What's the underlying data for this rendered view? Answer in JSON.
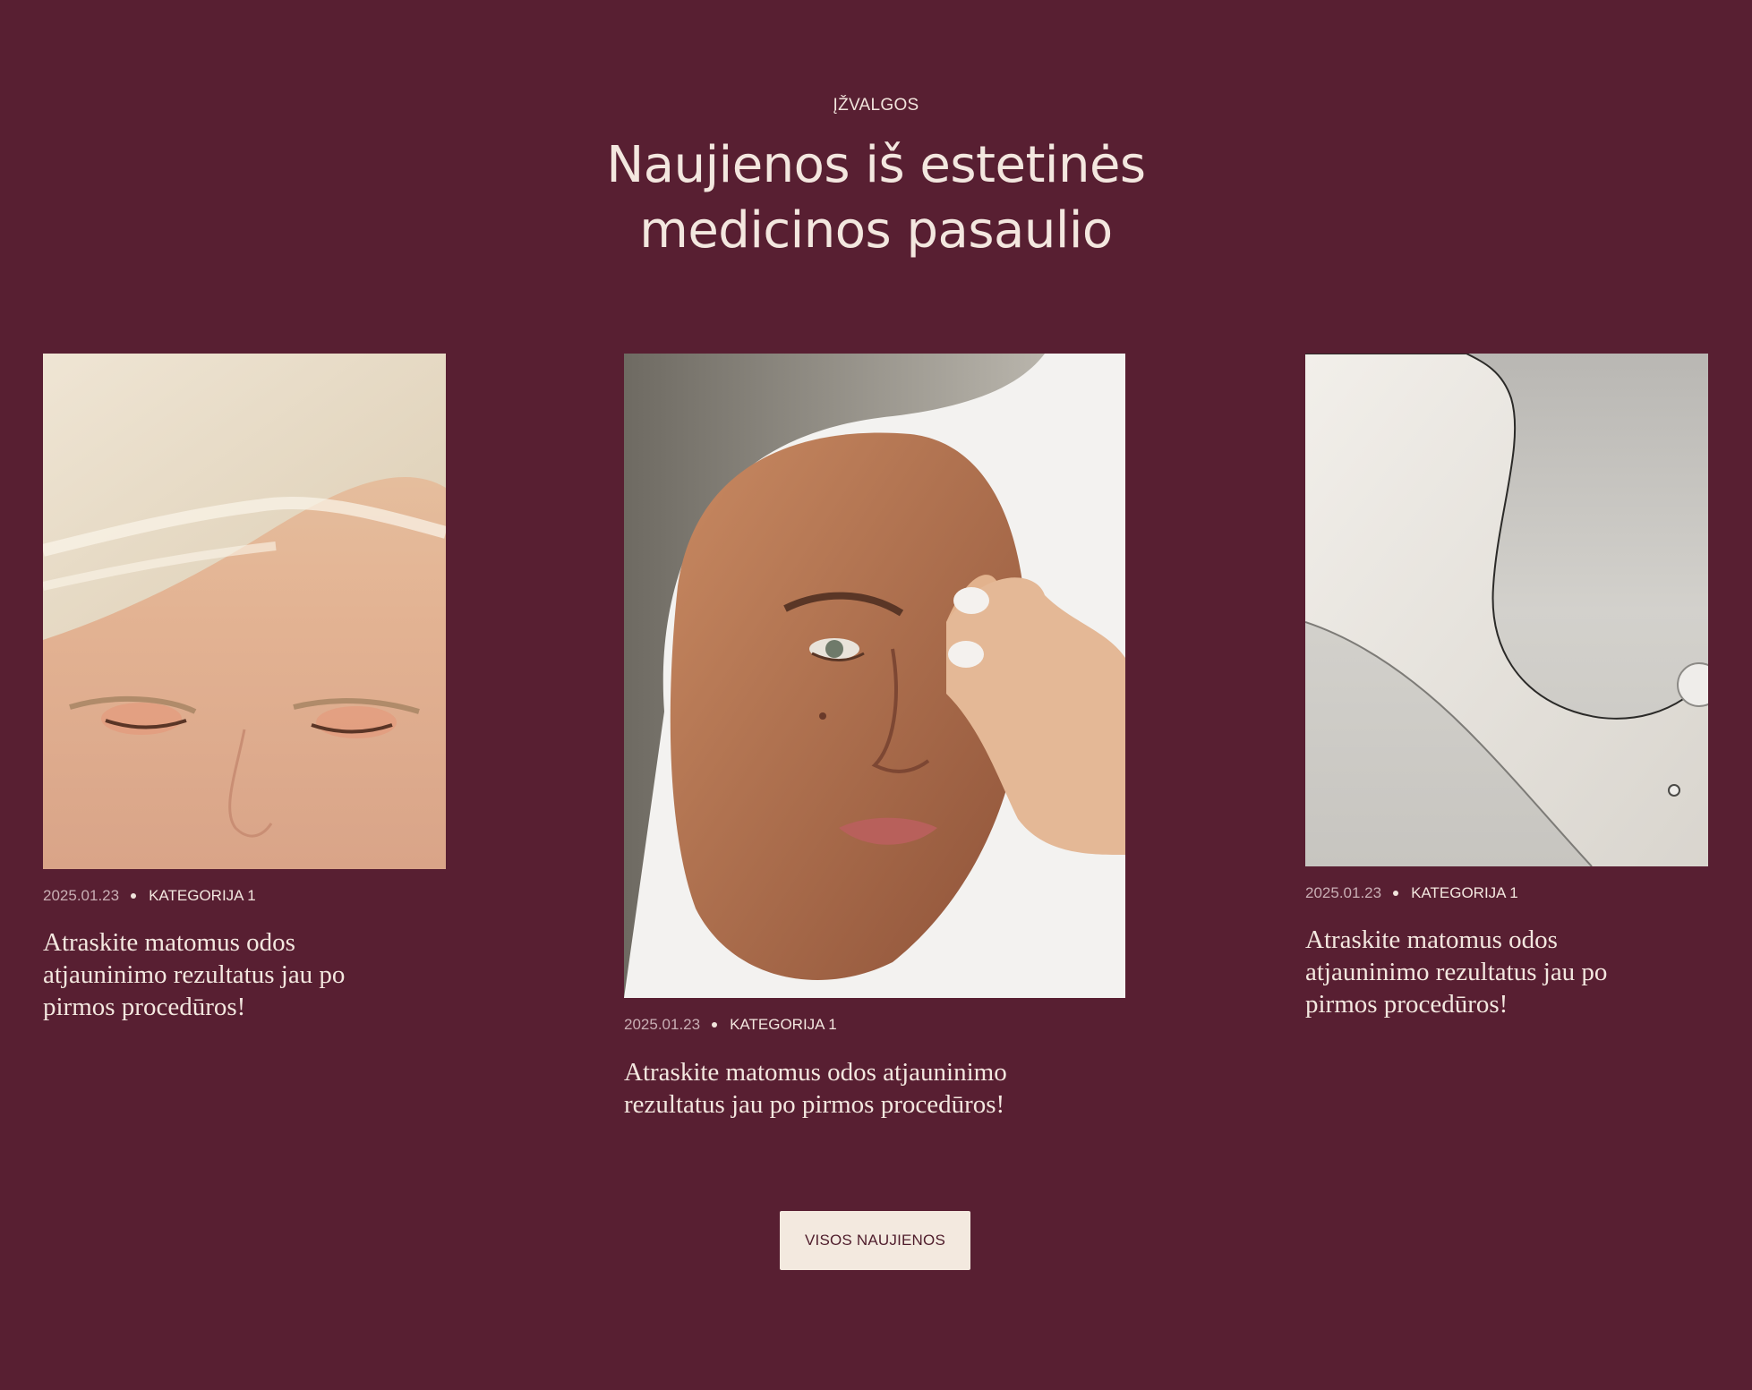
{
  "section": {
    "eyebrow": "ĮŽVALGOS",
    "title_line1": "Naujienos iš estetinės",
    "title_line2": "medicinos pasaulio"
  },
  "colors": {
    "background": "#581f32",
    "text_light": "#f3e7df",
    "button_bg": "#f3e9df",
    "button_text": "#4f1d2c"
  },
  "articles": [
    {
      "image_icon": "blonde-face-photo-icon",
      "date": "2025.01.23",
      "category": "KATEGORIJA 1",
      "title": "Atraskite matomus odos atjauninimo rezultatus jau po pirmos procedūros!"
    },
    {
      "image_icon": "woman-applying-cream-photo-icon",
      "date": "2025.01.23",
      "category": "KATEGORIJA 1",
      "title": "Atraskite matomus odos atjauninimo rezultatus jau po pirmos procedūros!"
    },
    {
      "image_icon": "cream-texture-photo-icon",
      "date": "2025.01.23",
      "category": "KATEGORIJA 1",
      "title": "Atraskite matomus odos atjauninimo rezultatus jau po pirmos procedūros!"
    }
  ],
  "cta": {
    "label": "VISOS NAUJIENOS"
  }
}
